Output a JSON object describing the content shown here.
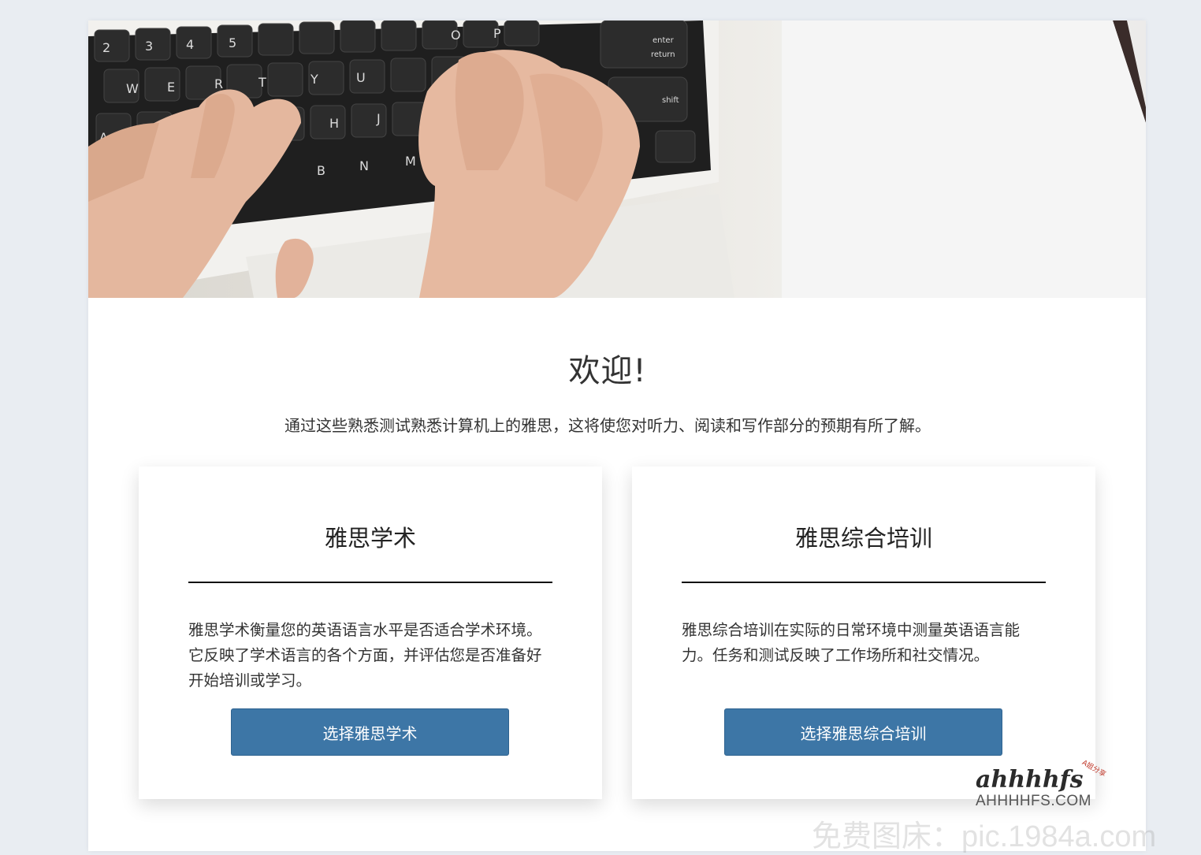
{
  "hero": {
    "image": "keyboard-typing-hands-photo"
  },
  "welcome": {
    "title": "欢迎!",
    "intro": "通过这些熟悉测试熟悉计算机上的雅思，这将使您对听力、阅读和写作部分的预期有所了解。"
  },
  "cards": [
    {
      "title": "雅思学术",
      "description": "雅思学术衡量您的英语语言水平是否适合学术环境。它反映了学术语言的各个方面，并评估您是否准备好开始培训或学习。",
      "button": "选择雅思学术"
    },
    {
      "title": "雅思综合培训",
      "description": "雅思综合培训在实际的日常环境中测量英语语言能力。任务和测试反映了工作场所和社交情况。",
      "button": "选择雅思综合培训"
    }
  ],
  "watermark": {
    "logo": "ahhhhfs",
    "tiny": "A姐分享",
    "site": "AHHHHFS.COM",
    "overlay": "免费图床：pic.1984a.com"
  },
  "colors": {
    "button": "#3d76a6",
    "background": "#e9edf2"
  }
}
